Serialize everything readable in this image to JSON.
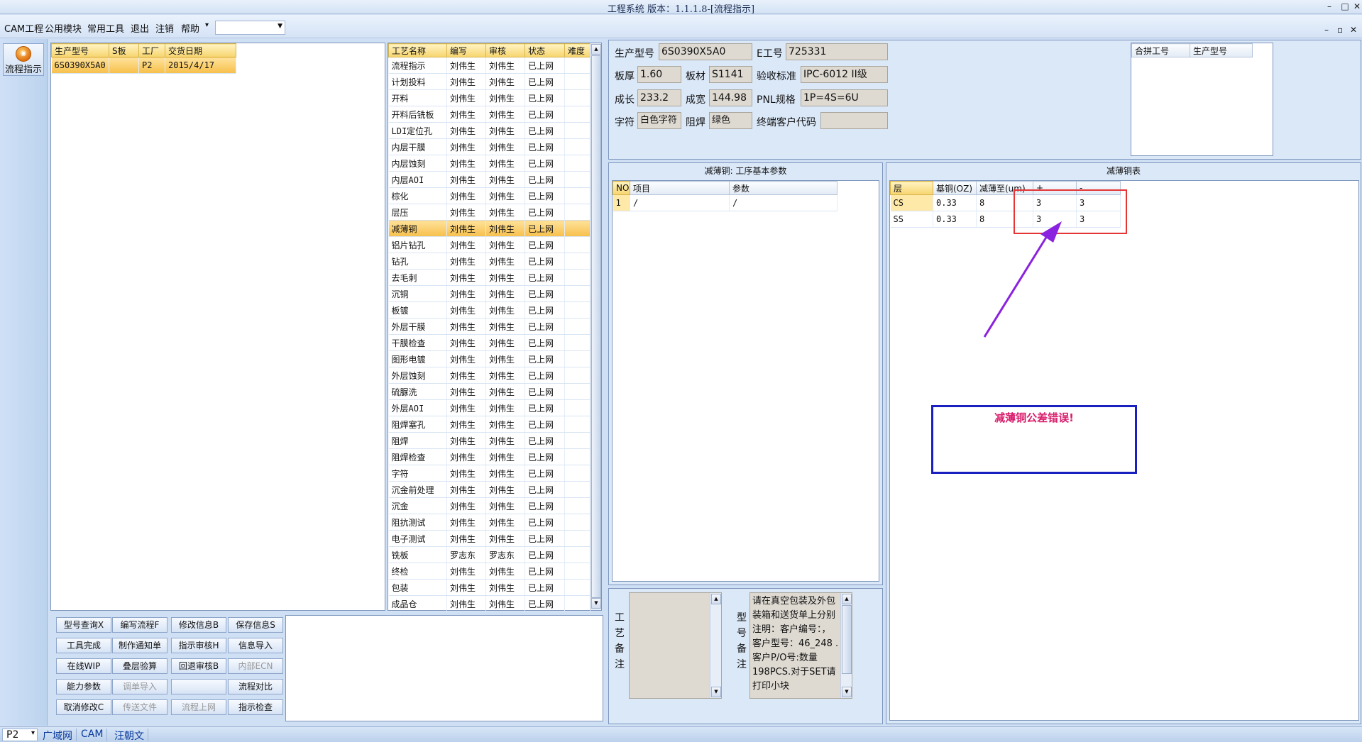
{
  "window": {
    "title": "工程系统 版本：1.1.1.8-[流程指示]",
    "controls": [
      "–",
      "□",
      "✕"
    ],
    "mdi_controls": [
      "–",
      "▫",
      "✕"
    ]
  },
  "menu": {
    "items": [
      "CAM工程",
      "公用模块",
      "常用工具",
      "退出",
      "注销",
      "帮助"
    ],
    "help_arrow": "▾",
    "combo_value": ""
  },
  "leftbar": {
    "flow_button_label": "流程指示"
  },
  "orders": {
    "headers": [
      "生产型号",
      "S板",
      "工厂",
      "交货日期"
    ],
    "rows": [
      {
        "model": "6S0390X5A0",
        "s": "",
        "factory": "P2",
        "date": "2015/4/17"
      }
    ]
  },
  "processes": {
    "headers": [
      "工艺名称",
      "编写",
      "审核",
      "状态",
      "难度"
    ],
    "rows": [
      [
        "流程指示",
        "刘伟生",
        "刘伟生",
        "已上网",
        ""
      ],
      [
        "计划投料",
        "刘伟生",
        "刘伟生",
        "已上网",
        ""
      ],
      [
        "开料",
        "刘伟生",
        "刘伟生",
        "已上网",
        ""
      ],
      [
        "开料后铣板",
        "刘伟生",
        "刘伟生",
        "已上网",
        ""
      ],
      [
        "LDI定位孔",
        "刘伟生",
        "刘伟生",
        "已上网",
        ""
      ],
      [
        "内层干膜",
        "刘伟生",
        "刘伟生",
        "已上网",
        ""
      ],
      [
        "内层蚀刻",
        "刘伟生",
        "刘伟生",
        "已上网",
        ""
      ],
      [
        "内层AOI",
        "刘伟生",
        "刘伟生",
        "已上网",
        ""
      ],
      [
        "棕化",
        "刘伟生",
        "刘伟生",
        "已上网",
        ""
      ],
      [
        "层压",
        "刘伟生",
        "刘伟生",
        "已上网",
        ""
      ],
      [
        "减薄铜",
        "刘伟生",
        "刘伟生",
        "已上网",
        ""
      ],
      [
        "铝片钻孔",
        "刘伟生",
        "刘伟生",
        "已上网",
        ""
      ],
      [
        "钻孔",
        "刘伟生",
        "刘伟生",
        "已上网",
        ""
      ],
      [
        "去毛刺",
        "刘伟生",
        "刘伟生",
        "已上网",
        ""
      ],
      [
        "沉铜",
        "刘伟生",
        "刘伟生",
        "已上网",
        ""
      ],
      [
        "板镀",
        "刘伟生",
        "刘伟生",
        "已上网",
        ""
      ],
      [
        "外层干膜",
        "刘伟生",
        "刘伟生",
        "已上网",
        ""
      ],
      [
        "干膜检查",
        "刘伟生",
        "刘伟生",
        "已上网",
        ""
      ],
      [
        "图形电镀",
        "刘伟生",
        "刘伟生",
        "已上网",
        ""
      ],
      [
        "外层蚀刻",
        "刘伟生",
        "刘伟生",
        "已上网",
        ""
      ],
      [
        "硫脲洗",
        "刘伟生",
        "刘伟生",
        "已上网",
        ""
      ],
      [
        "外层AOI",
        "刘伟生",
        "刘伟生",
        "已上网",
        ""
      ],
      [
        "阻焊塞孔",
        "刘伟生",
        "刘伟生",
        "已上网",
        ""
      ],
      [
        "阻焊",
        "刘伟生",
        "刘伟生",
        "已上网",
        ""
      ],
      [
        "阻焊检查",
        "刘伟生",
        "刘伟生",
        "已上网",
        ""
      ],
      [
        "字符",
        "刘伟生",
        "刘伟生",
        "已上网",
        ""
      ],
      [
        "沉金前处理",
        "刘伟生",
        "刘伟生",
        "已上网",
        ""
      ],
      [
        "沉金",
        "刘伟生",
        "刘伟生",
        "已上网",
        ""
      ],
      [
        "阻抗测试",
        "刘伟生",
        "刘伟生",
        "已上网",
        ""
      ],
      [
        "电子测试",
        "刘伟生",
        "刘伟生",
        "已上网",
        ""
      ],
      [
        "铣板",
        "罗志东",
        "罗志东",
        "已上网",
        ""
      ],
      [
        "终检",
        "刘伟生",
        "刘伟生",
        "已上网",
        ""
      ],
      [
        "包装",
        "刘伟生",
        "刘伟生",
        "已上网",
        ""
      ],
      [
        "成品仓",
        "刘伟生",
        "刘伟生",
        "已上网",
        ""
      ]
    ],
    "selected_index": 10
  },
  "buttons": [
    [
      "型号查询X",
      "编写流程F",
      "修改信息B",
      "保存信息S"
    ],
    [
      "工具完成",
      "制作通知单",
      "指示审核H",
      "信息导入"
    ],
    [
      "在线WIP",
      "叠层验算",
      "回退审核B",
      "内部ECN"
    ],
    [
      "能力参数",
      "调单导入",
      "",
      "流程对比"
    ],
    [
      "取消修改C",
      "传送文件",
      "流程上网",
      "指示检查"
    ]
  ],
  "disabled_buttons": [
    "内部ECN",
    "调单导入",
    "传送文件",
    "流程上网",
    ""
  ],
  "info": {
    "model_label": "生产型号",
    "model": "6S0390X5A0",
    "e_label": "E工号",
    "e_no": "725331",
    "thick_label": "板厚",
    "thick": "1.60",
    "material_label": "板材",
    "material": "S1141",
    "std_label": "验收标准",
    "std": "IPC-6012 II级",
    "len_label": "成长",
    "len": "233.2",
    "wid_label": "成宽",
    "wid": "144.98",
    "pnl_label": "PNL规格",
    "pnl": "1P=4S=6U",
    "char_label": "字符",
    "char": "白色字符",
    "mask_label": "阻焊",
    "mask": "绿色",
    "cust_label": "终端客户代码",
    "cust": ""
  },
  "merge": {
    "headers": [
      "合拼工号",
      "生产型号"
    ]
  },
  "params": {
    "title": "减薄铜: 工序基本参数",
    "headers": [
      "NO",
      "项目",
      "参数"
    ],
    "rows": [
      [
        "1",
        "/",
        "/"
      ]
    ]
  },
  "thin_table": {
    "title": "减薄铜表",
    "headers": [
      "层",
      "基铜(OZ)",
      "减薄至(um)",
      "+",
      "-"
    ],
    "rows": [
      [
        "CS",
        "0.33",
        "8",
        "3",
        "3"
      ],
      [
        "SS",
        "0.33",
        "8",
        "3",
        "3"
      ]
    ]
  },
  "error_message": "减薄铜公差错误!",
  "remarks": {
    "process_label": "工艺备注",
    "model_label": "型号备注",
    "model_text": "请在真空包装及外包装箱和送货单上分别注明：客户编号：，客户型号：46_248 .客户P/O号:数量198PCS.对于SET请打印小块"
  },
  "status": {
    "combo": "P2",
    "combo_arrow": "▾",
    "cells": [
      "广域网",
      "CAM",
      "汪朝文"
    ]
  },
  "colors": {
    "arrow": "#8a22e0",
    "highlight_box": "#e53535",
    "message_border": "#1a1fbf",
    "message_text": "#d91c6b"
  }
}
